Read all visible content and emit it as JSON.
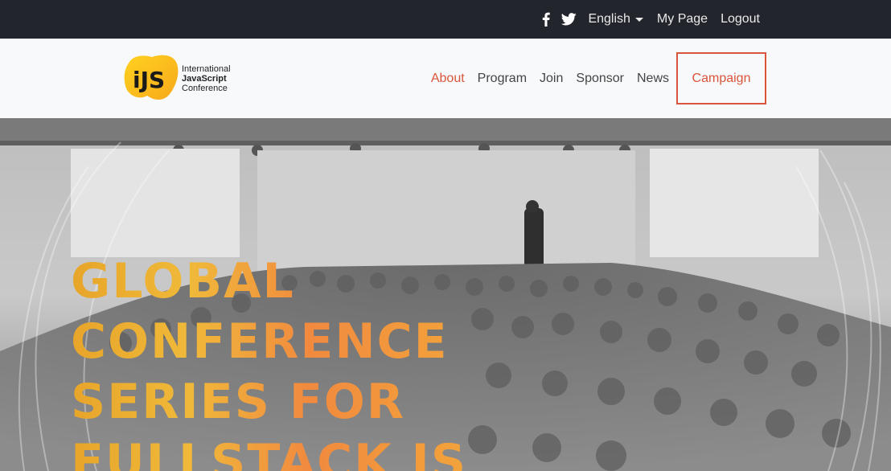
{
  "topbar": {
    "facebook_icon": "facebook-icon",
    "twitter_icon": "twitter-icon",
    "language": "English",
    "my_page": "My Page",
    "logout": "Logout"
  },
  "brand": {
    "mark": "iJS",
    "line1": "International",
    "line2": "JavaScript",
    "line3": "Conference"
  },
  "nav": {
    "items": [
      "About",
      "Program",
      "Join",
      "Sponsor",
      "News"
    ],
    "active": "About",
    "campaign": "Campaign"
  },
  "hero": {
    "headline": [
      "GLOBAL",
      "CONFERENCE",
      "SERIES FOR",
      "FULLSTACK JS"
    ]
  },
  "colors": {
    "accent": "#d9553b",
    "topbar_bg": "#22252b",
    "navbar_bg": "#f8f9fa",
    "headline_gradient": [
      "#e7a52a",
      "#f18a3f"
    ]
  }
}
